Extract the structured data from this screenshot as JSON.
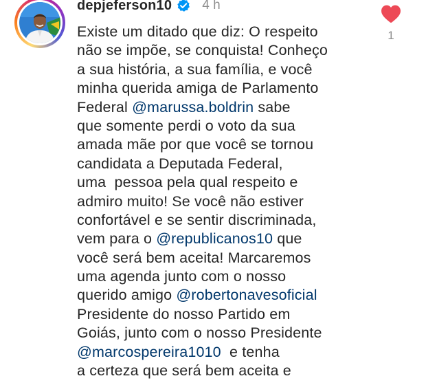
{
  "comment": {
    "username": "depjeferson10",
    "time": "4 h",
    "likes": "1",
    "liked": true,
    "verified": true,
    "colors": {
      "text": "#262626",
      "mention": "#00376b",
      "meta": "#8e8e8e",
      "heart": "#ed4956",
      "verified": "#0095f6"
    },
    "icons": {
      "verified": "verified-badge-icon",
      "heart": "heart-filled-icon"
    },
    "lines": [
      [
        {
          "t": "Existe um ditado que diz: O respeito"
        }
      ],
      [
        {
          "t": "não se impõe, se conquista! Conheço"
        }
      ],
      [
        {
          "t": "a sua história, a sua família, e você"
        }
      ],
      [
        {
          "t": "minha querida amiga de Parlamento"
        }
      ],
      [
        {
          "t": "Federal "
        },
        {
          "t": "@marussa.boldrin",
          "m": true
        },
        {
          "t": " sabe"
        }
      ],
      [
        {
          "t": "que somente perdi o voto da sua"
        }
      ],
      [
        {
          "t": "amada mãe por que você se tornou"
        }
      ],
      [
        {
          "t": "candidata a Deputada Federal,"
        }
      ],
      [
        {
          "t": "uma  pessoa pela qual respeito e"
        }
      ],
      [
        {
          "t": "admiro muito! Se você não estiver"
        }
      ],
      [
        {
          "t": "confortável e se sentir discriminada,"
        }
      ],
      [
        {
          "t": "vem para o "
        },
        {
          "t": "@republicanos10",
          "m": true
        },
        {
          "t": " que"
        }
      ],
      [
        {
          "t": "você será bem aceita! Marcaremos"
        }
      ],
      [
        {
          "t": "uma agenda junto com o nosso"
        }
      ],
      [
        {
          "t": "querido amigo "
        },
        {
          "t": "@robertonavesoficial",
          "m": true
        }
      ],
      [
        {
          "t": "Presidente do nosso Partido em"
        }
      ],
      [
        {
          "t": "Goiás, junto com o nosso Presidente"
        }
      ],
      [
        {
          "t": "@marcospereira1010",
          "m": true
        },
        {
          "t": "  e tenha"
        }
      ],
      [
        {
          "t": "a certeza que será bem aceita e"
        }
      ]
    ]
  }
}
